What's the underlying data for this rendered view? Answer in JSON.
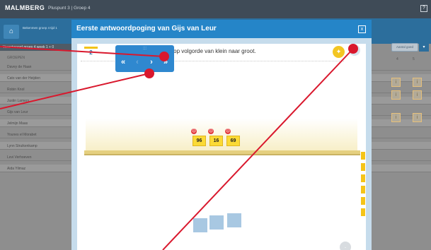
{
  "topbar": {
    "logo": "MALMBERG",
    "crumb": "Pluspunt 3  |  Groep 4",
    "help_label": "?"
  },
  "group": {
    "home_icon": "home-icon",
    "selector": "Bekenmen groep 4 tijd 1"
  },
  "students": {
    "panel_title": "Verantwoord groep 4 week 1 + 0",
    "header": "GROEPEN",
    "rows": [
      "Davey de Haan",
      "Cato van der Heijden",
      "Robin Knol",
      "Justin Lamers",
      "Gijs van Leur",
      "Jelmijn Maas",
      "Younes el Morabet",
      "Lynn Struikenkamp",
      "Levi Verhoeven",
      "Aida Yilmaz"
    ],
    "result_button": "Aantal goed",
    "columns": [
      "4",
      "5"
    ]
  },
  "modal": {
    "title": "Eerste antwoordpoging van Gijs van Leur",
    "close_label": "x",
    "question_number": "2",
    "question_text": "ep op volgorde van klein naar groot.",
    "numbers": [
      "96",
      "16",
      "69"
    ],
    "navigator": {
      "grip": ":::",
      "first": "«",
      "prev": "‹",
      "next": "›",
      "last": "»"
    }
  },
  "colors": {
    "header_blue": "#2585c8",
    "card_yellow": "#fbda35",
    "annotation_red": "#d9182d"
  }
}
